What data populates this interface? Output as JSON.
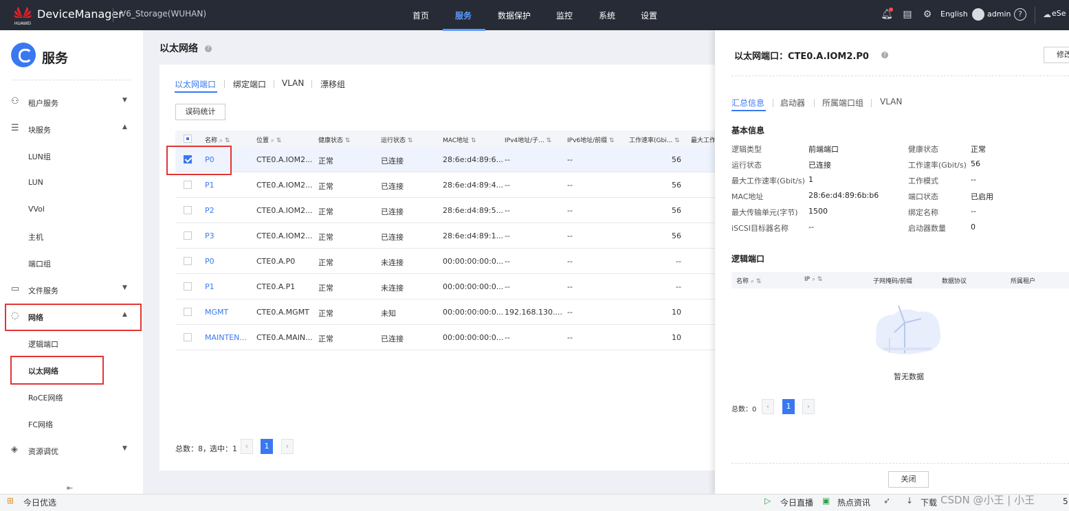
{
  "topbar": {
    "brand": "DeviceManager",
    "logo_text": "HUAWEI",
    "storage": "V6_Storage(WUHAN)",
    "nav": [
      "首页",
      "服务",
      "数据保护",
      "监控",
      "系统",
      "设置"
    ],
    "active_nav": "服务",
    "language": "English",
    "user": "admin",
    "extra": "eSe",
    "icons": [
      "bell-icon",
      "clipboard-icon",
      "gear-icon",
      "avatar-icon",
      "help-icon",
      "cloud-icon"
    ]
  },
  "sidebar": {
    "title": "服务",
    "groups": [
      {
        "label": "租户服务",
        "icon": "users-icon"
      },
      {
        "label": "块服务",
        "icon": "database-icon"
      },
      {
        "label": "文件服务",
        "icon": "folder-icon"
      },
      {
        "label": "网络",
        "icon": "network-icon"
      },
      {
        "label": "资源调优",
        "icon": "layers-icon"
      }
    ],
    "block_items": [
      "LUN组",
      "LUN",
      "VVol",
      "主机",
      "端口组"
    ],
    "network_items": [
      "逻辑端口",
      "以太网络",
      "RoCE网络",
      "FC网络"
    ],
    "selected": "以太网络"
  },
  "main": {
    "title": "以太网络",
    "tabs": [
      "以太网端口",
      "绑定端口",
      "VLAN",
      "漂移组"
    ],
    "active_tab": "以太网端口",
    "error_stats_button": "误码统计",
    "columns": [
      "名称",
      "位置",
      "健康状态",
      "运行状态",
      "MAC地址",
      "IPv4地址/子...",
      "IPv6地址/前缀",
      "工作速率(Gbi...",
      "最大工作"
    ],
    "rows": [
      {
        "name": "P0",
        "location": "CTE0.A.IOM2...",
        "health": "正常",
        "run": "已连接",
        "mac": "28:6e:d4:89:6...",
        "ipv4": "--",
        "ipv6": "--",
        "speed": "56",
        "checked": true
      },
      {
        "name": "P1",
        "location": "CTE0.A.IOM2...",
        "health": "正常",
        "run": "已连接",
        "mac": "28:6e:d4:89:4...",
        "ipv4": "--",
        "ipv6": "--",
        "speed": "56",
        "checked": false
      },
      {
        "name": "P2",
        "location": "CTE0.A.IOM2...",
        "health": "正常",
        "run": "已连接",
        "mac": "28:6e:d4:89:5...",
        "ipv4": "--",
        "ipv6": "--",
        "speed": "56",
        "checked": false
      },
      {
        "name": "P3",
        "location": "CTE0.A.IOM2...",
        "health": "正常",
        "run": "已连接",
        "mac": "28:6e:d4:89:1...",
        "ipv4": "--",
        "ipv6": "--",
        "speed": "56",
        "checked": false
      },
      {
        "name": "P0",
        "location": "CTE0.A.P0",
        "health": "正常",
        "run": "未连接",
        "mac": "00:00:00:00:0...",
        "ipv4": "--",
        "ipv6": "--",
        "speed": "--",
        "checked": false
      },
      {
        "name": "P1",
        "location": "CTE0.A.P1",
        "health": "正常",
        "run": "未连接",
        "mac": "00:00:00:00:0...",
        "ipv4": "--",
        "ipv6": "--",
        "speed": "--",
        "checked": false
      },
      {
        "name": "MGMT",
        "location": "CTE0.A.MGMT",
        "health": "正常",
        "run": "未知",
        "mac": "00:00:00:00:0...",
        "ipv4": "192.168.130....",
        "ipv6": "--",
        "speed": "10",
        "checked": false
      },
      {
        "name": "MAINTEN...",
        "location": "CTE0.A.MAIN...",
        "health": "正常",
        "run": "已连接",
        "mac": "00:00:00:00:0...",
        "ipv4": "--",
        "ipv6": "--",
        "speed": "10",
        "checked": false
      }
    ],
    "footer": {
      "total": "总数：8，",
      "selected": "选中：1",
      "page": "1",
      "prev": "‹",
      "next": "›"
    }
  },
  "panel": {
    "title": "以太网端口：CTE0.A.IOM2.P0",
    "modify_button": "修改",
    "tabs": [
      "汇总信息",
      "启动器",
      "所属端口组",
      "VLAN"
    ],
    "active_tab": "汇总信息",
    "basic_title": "基本信息",
    "left_fields": [
      {
        "label": "逻辑类型",
        "value": "前端端口"
      },
      {
        "label": "运行状态",
        "value": "已连接"
      },
      {
        "label": "最大工作速率(Gbit/s)",
        "value": "1"
      },
      {
        "label": "MAC地址",
        "value": "28:6e:d4:89:6b:b6"
      },
      {
        "label": "最大传输单元(字节)",
        "value": "1500"
      },
      {
        "label": "iSCSI目标器名称",
        "value": "--"
      }
    ],
    "right_fields": [
      {
        "label": "健康状态",
        "value": "正常"
      },
      {
        "label": "工作速率(Gbit/s)",
        "value": "56"
      },
      {
        "label": "工作模式",
        "value": "--"
      },
      {
        "label": "端口状态",
        "value": "已启用"
      },
      {
        "label": "绑定名称",
        "value": "--"
      },
      {
        "label": "启动器数量",
        "value": "0"
      }
    ],
    "logical_title": "逻辑端口",
    "logical_columns": [
      "名称",
      "IP",
      "子网掩码/前缀",
      "数据协议",
      "所属租户"
    ],
    "empty_text": "暂无数据",
    "footer": {
      "total": "总数：0",
      "page": "1",
      "prev": "‹",
      "next": "›"
    },
    "close_button": "关闭"
  },
  "statusbar": {
    "left": "今日优选",
    "live": "今日直播",
    "news": "热点资讯",
    "download": "下载",
    "watermark": "CSDN @小王 | 小王",
    "trail": "5"
  },
  "colors": {
    "accent": "#3a78f2",
    "topbar": "#262b36",
    "highlight": "#e23434"
  }
}
